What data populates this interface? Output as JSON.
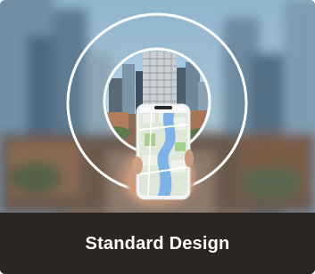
{
  "card": {
    "caption": "Standard Design"
  },
  "hero": {
    "icon": "ar-phone-city-icon"
  },
  "colors": {
    "caption_bg": "#2b2622",
    "caption_text": "#ffffff",
    "ring": "#ffffff"
  }
}
